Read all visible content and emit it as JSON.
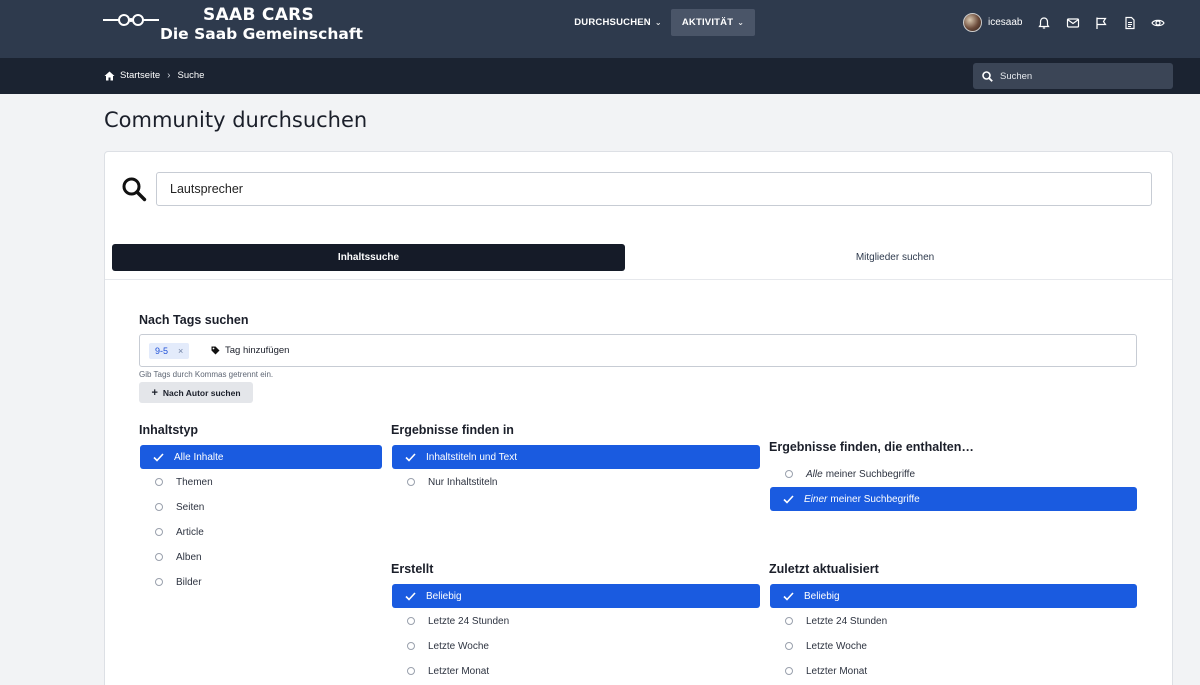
{
  "header": {
    "brand_line1": "SAAB CARS",
    "brand_line2": "Die Saab Gemeinschaft",
    "nav": [
      {
        "label": "DURCHSUCHEN"
      },
      {
        "label": "AKTIVITÄT"
      }
    ],
    "username": "icesaab"
  },
  "breadcrumb": {
    "home": "Startseite",
    "current": "Suche"
  },
  "top_search": {
    "placeholder": "Suchen"
  },
  "page_title": "Community durchsuchen",
  "search": {
    "value": "Lautsprecher"
  },
  "tabs": {
    "content": "Inhaltssuche",
    "members": "Mitglieder suchen"
  },
  "tags": {
    "label": "Nach Tags suchen",
    "chips": [
      "9-5"
    ],
    "add_label": "Tag hinzufügen",
    "hint": "Gib Tags durch Kommas getrennt ein.",
    "author_button": "Nach Autor suchen"
  },
  "content_type": {
    "title": "Inhaltstyp",
    "options": [
      "Alle Inhalte",
      "Themen",
      "Seiten",
      "Article",
      "Alben",
      "Bilder"
    ],
    "selected": 0
  },
  "find_in": {
    "title": "Ergebnisse finden in",
    "options": [
      "Inhaltstiteln und Text",
      "Nur Inhaltstiteln"
    ],
    "selected": 0
  },
  "contains": {
    "title": "Ergebnisse finden, die enthalten…",
    "options": [
      {
        "em": "Alle",
        "rest": "meiner Suchbegriffe"
      },
      {
        "em": "Einer",
        "rest": "meiner Suchbegriffe"
      }
    ],
    "selected": 1
  },
  "created": {
    "title": "Erstellt",
    "options": [
      "Beliebig",
      "Letzte 24 Stunden",
      "Letzte Woche",
      "Letzter Monat"
    ],
    "selected": 0
  },
  "updated": {
    "title": "Zuletzt aktualisiert",
    "options": [
      "Beliebig",
      "Letzte 24 Stunden",
      "Letzte Woche",
      "Letzter Monat"
    ],
    "selected": 0
  },
  "colors": {
    "header_bg": "#2e3a4d",
    "crumb_bg": "#1b2331",
    "accent": "#1a5be0",
    "tab_active": "#151b28"
  },
  "icons": [
    "saab-logo-icon",
    "chevron-down-icon",
    "bell-icon",
    "mail-icon",
    "flag-icon",
    "document-icon",
    "eye-icon",
    "home-icon",
    "search-icon",
    "tag-icon",
    "check-icon",
    "radio-icon"
  ]
}
